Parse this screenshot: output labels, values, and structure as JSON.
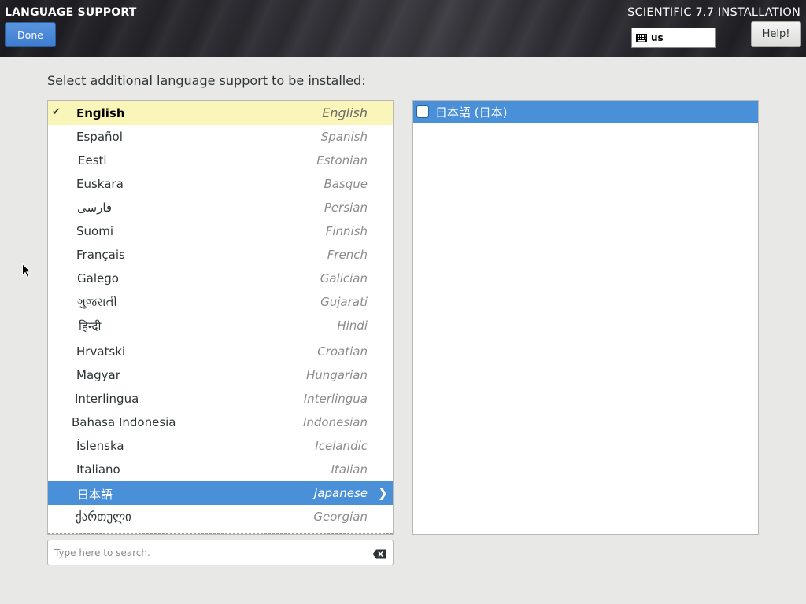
{
  "header": {
    "screen_title": "LANGUAGE SUPPORT",
    "product_title": "SCIENTIFIC 7.7 INSTALLATION",
    "done_label": "Done",
    "help_label": "Help!",
    "keyboard_layout": "us",
    "keyboard_icon": "keyboard-icon"
  },
  "instruction": "Select additional language support to be installed:",
  "languages": [
    {
      "native": "English",
      "english": "English",
      "state": "installed"
    },
    {
      "native": "Español",
      "english": "Spanish"
    },
    {
      "native": "Eesti",
      "english": "Estonian"
    },
    {
      "native": "Euskara",
      "english": "Basque"
    },
    {
      "native": "فارسی",
      "english": "Persian"
    },
    {
      "native": "Suomi",
      "english": "Finnish"
    },
    {
      "native": "Français",
      "english": "French"
    },
    {
      "native": "Galego",
      "english": "Galician"
    },
    {
      "native": "ગુજરાતી",
      "english": "Gujarati"
    },
    {
      "native": "हिन्दी",
      "english": "Hindi"
    },
    {
      "native": "Hrvatski",
      "english": "Croatian"
    },
    {
      "native": "Magyar",
      "english": "Hungarian"
    },
    {
      "native": "Interlingua",
      "english": "Interlingua"
    },
    {
      "native": "Bahasa Indonesia",
      "english": "Indonesian"
    },
    {
      "native": "Íslenska",
      "english": "Icelandic"
    },
    {
      "native": "Italiano",
      "english": "Italian"
    },
    {
      "native": "日本語",
      "english": "Japanese",
      "state": "selected"
    },
    {
      "native": "ქართული",
      "english": "Georgian"
    }
  ],
  "locales": [
    {
      "label": "日本語 (日本)",
      "checked": false
    }
  ],
  "search": {
    "placeholder": "Type here to search.",
    "value": ""
  },
  "colors": {
    "accent": "#4a90d9",
    "installed_highlight": "#faf5b8"
  }
}
